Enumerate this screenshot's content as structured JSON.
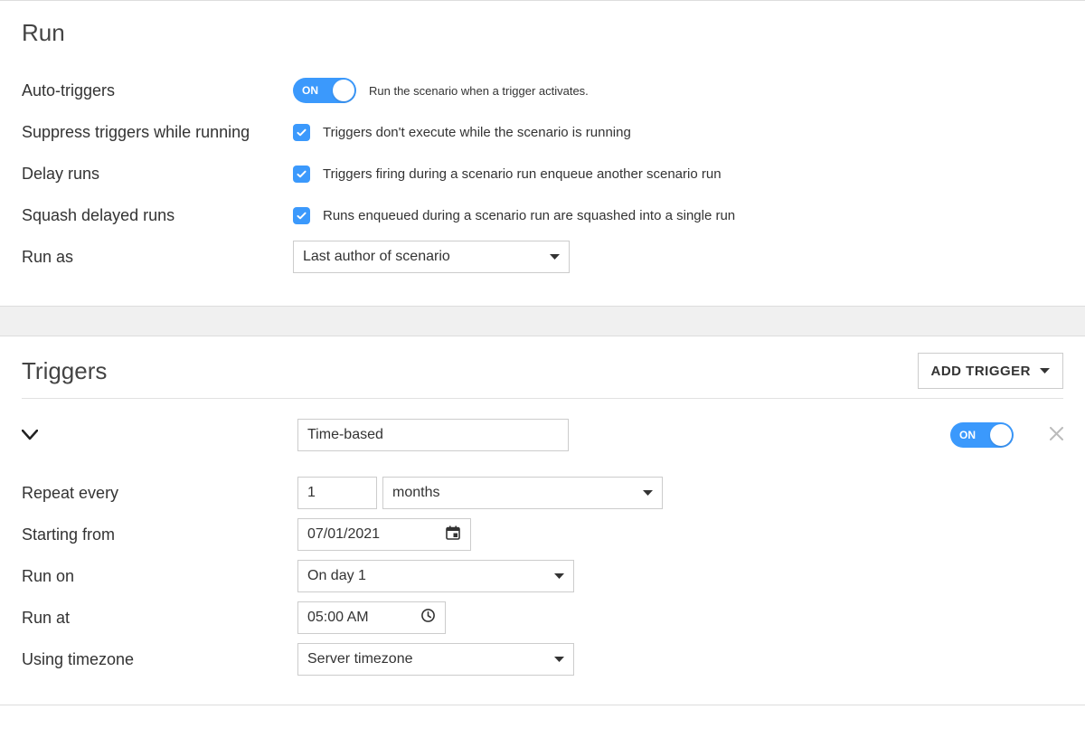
{
  "run": {
    "title": "Run",
    "auto_triggers": {
      "label": "Auto-triggers",
      "on_text": "ON",
      "hint": "Run the scenario when a trigger activates."
    },
    "suppress": {
      "label": "Suppress triggers while running",
      "hint": "Triggers don't execute while the scenario is running"
    },
    "delay": {
      "label": "Delay runs",
      "hint": "Triggers firing during a scenario run enqueue another scenario run"
    },
    "squash": {
      "label": "Squash delayed runs",
      "hint": "Runs enqueued during a scenario run are squashed into a single run"
    },
    "run_as": {
      "label": "Run as",
      "value": "Last author of scenario"
    }
  },
  "triggers": {
    "title": "Triggers",
    "add_label": "ADD TRIGGER",
    "item": {
      "type_value": "Time-based",
      "on_text": "ON",
      "repeat_label": "Repeat every",
      "repeat_value": "1",
      "repeat_unit": "months",
      "start_label": "Starting from",
      "start_value": "07/01/2021",
      "run_on_label": "Run on",
      "run_on_value": "On day 1",
      "run_at_label": "Run at",
      "run_at_value": "05:00 AM",
      "tz_label": "Using timezone",
      "tz_value": "Server timezone"
    }
  }
}
